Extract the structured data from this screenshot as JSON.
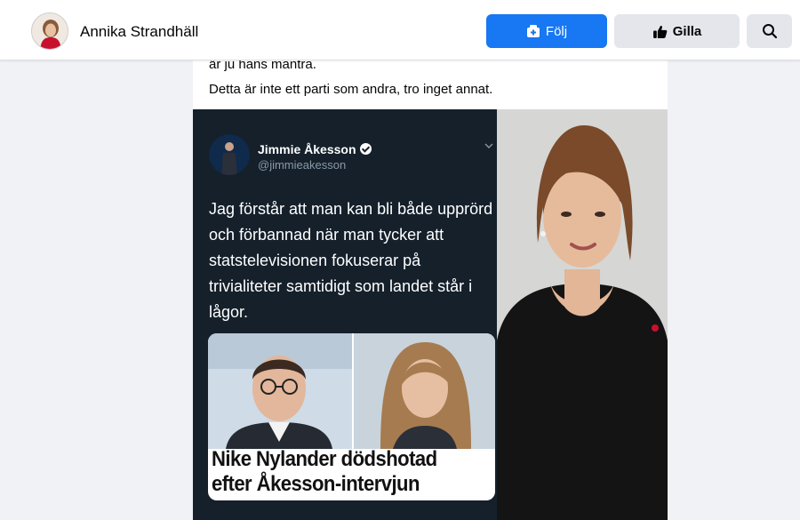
{
  "header": {
    "page_name": "Annika Strandhäll",
    "follow_label": "Följ",
    "like_label": "Gilla"
  },
  "post": {
    "text_line_1": "är ju hans mantra.",
    "text_line_2": "Detta är inte ett parti som andra, tro inget annat."
  },
  "tweet": {
    "author_name": "Jimmie Åkesson",
    "handle": "@jimmieakesson",
    "body": "Jag förstår att man kan bli både upprörd och förbannad när man tycker att statstelevisionen fokuserar på trivialiteter samtidigt som landet står i lågor.",
    "card_headline_1": "Nike Nylander dödshotad",
    "card_headline_2": "efter Åkesson-intervjun"
  },
  "colors": {
    "primary": "#1877f2",
    "tweet_bg": "#15202b",
    "secondary_button": "#e4e6eb"
  },
  "icons": {
    "follow": "follow-box-icon",
    "like": "thumbs-up-icon",
    "search": "search-icon"
  }
}
